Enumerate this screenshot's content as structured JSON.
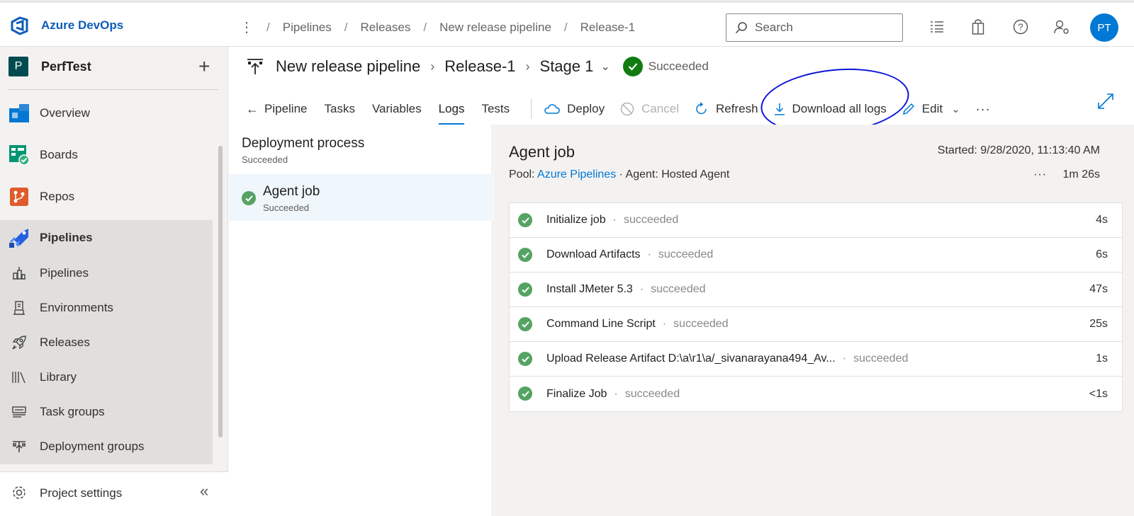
{
  "app": {
    "name": "Azure DevOps"
  },
  "breadcrumb": [
    "Pipelines",
    "Releases",
    "New release pipeline",
    "Release-1"
  ],
  "search": {
    "placeholder": "Search"
  },
  "user": {
    "initials": "PT"
  },
  "project": {
    "badge": "P",
    "name": "PerfTest"
  },
  "sidebar": {
    "items": [
      {
        "label": "Overview",
        "icon": "overview-icon"
      },
      {
        "label": "Boards",
        "icon": "boards-icon"
      },
      {
        "label": "Repos",
        "icon": "repos-icon"
      },
      {
        "label": "Pipelines",
        "icon": "pipelines-icon"
      },
      {
        "label": "Pipelines",
        "icon": "pipelines-sub-icon"
      },
      {
        "label": "Environments",
        "icon": "environments-icon"
      },
      {
        "label": "Releases",
        "icon": "releases-icon"
      },
      {
        "label": "Library",
        "icon": "library-icon"
      },
      {
        "label": "Task groups",
        "icon": "task-groups-icon"
      },
      {
        "label": "Deployment groups",
        "icon": "deployment-groups-icon"
      }
    ],
    "settings_label": "Project settings"
  },
  "title": {
    "pipeline": "New release pipeline",
    "release": "Release-1",
    "stage": "Stage 1",
    "status": "Succeeded"
  },
  "tabs": [
    "Pipeline",
    "Tasks",
    "Variables",
    "Logs",
    "Tests"
  ],
  "toolbar": {
    "deploy": "Deploy",
    "cancel": "Cancel",
    "refresh": "Refresh",
    "download": "Download all logs",
    "edit": "Edit",
    "more": "···"
  },
  "left": {
    "process_title": "Deployment process",
    "process_status": "Succeeded",
    "job_name": "Agent job",
    "job_status": "Succeeded"
  },
  "agent": {
    "title": "Agent job",
    "started": "Started: 9/28/2020, 11:13:40 AM",
    "pool_label": "Pool:",
    "pool_link": "Azure Pipelines",
    "agent_text": "· Agent: Hosted Agent",
    "dots": "···",
    "duration": "1m 26s"
  },
  "steps": [
    {
      "name": "Initialize job",
      "status": "succeeded",
      "duration": "4s"
    },
    {
      "name": "Download Artifacts",
      "status": "succeeded",
      "duration": "6s"
    },
    {
      "name": "Install JMeter 5.3",
      "status": "succeeded",
      "duration": "47s"
    },
    {
      "name": "Command Line Script",
      "status": "succeeded",
      "duration": "25s"
    },
    {
      "name": "Upload Release Artifact D:\\a\\r1\\a/_sivanarayana494_Av...",
      "status": "succeeded",
      "duration": "1s"
    },
    {
      "name": "Finalize Job",
      "status": "succeeded",
      "duration": "<1s"
    }
  ],
  "colors": {
    "accent": "#0078d4",
    "success": "#107c10",
    "annotation": "#0b14d8"
  }
}
